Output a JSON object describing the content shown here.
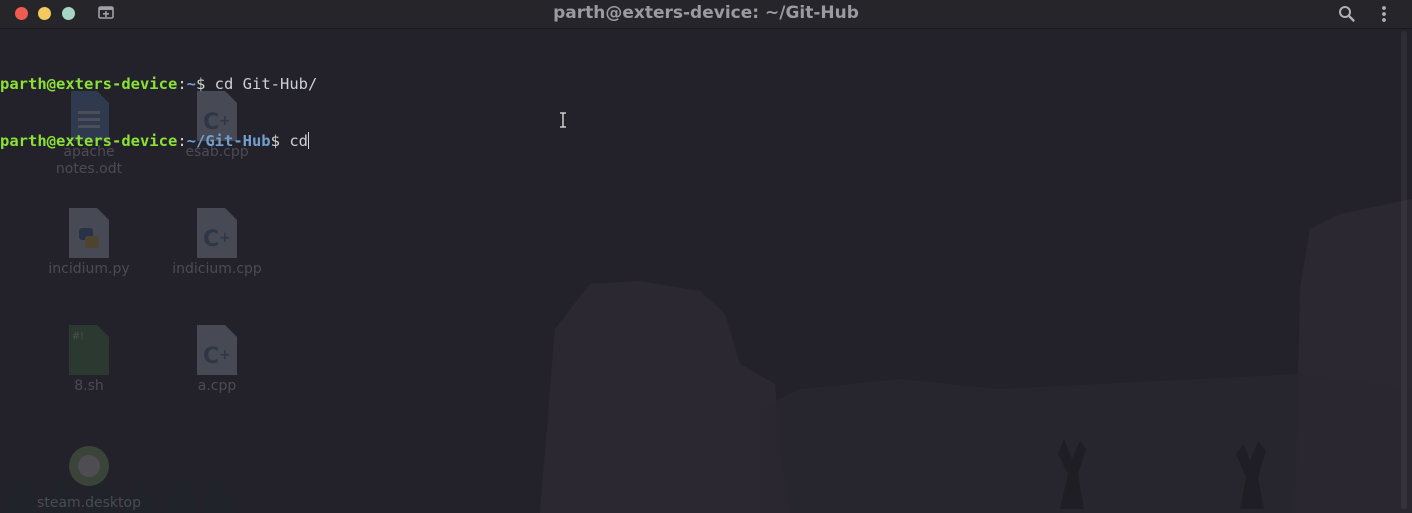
{
  "window": {
    "title": "parth@exters-device: ~/Git-Hub",
    "controls": [
      "close",
      "minimize",
      "maximize"
    ],
    "new_tab_icon": "new-tab-icon",
    "search_icon": "search-icon",
    "menu_icon": "kebab-menu-icon"
  },
  "terminal": {
    "lines": [
      {
        "user_host": "parth@exters-device",
        "colon": ":",
        "path": "~",
        "symbol": "$",
        "command": " cd Git-Hub/"
      },
      {
        "user_host": "parth@exters-device",
        "colon": ":",
        "path": "~/Git-Hub",
        "symbol": "$",
        "command": " cd"
      }
    ]
  },
  "desktop_icons": [
    {
      "label_line1": "apache",
      "label_line2": "notes.odt",
      "icon": "document-icon"
    },
    {
      "label": "esab.cpp",
      "icon": "cpp-file-icon"
    },
    {
      "label": "incidium.py",
      "icon": "python-file-icon"
    },
    {
      "label": "indicium.cpp",
      "icon": "cpp-file-icon"
    },
    {
      "label": "8.sh",
      "icon": "shell-script-icon"
    },
    {
      "label": "a.cpp",
      "icon": "cpp-file-icon"
    },
    {
      "label": "steam.desktop",
      "icon": "steam-icon"
    }
  ],
  "colors": {
    "prompt_user": "#8ae234",
    "prompt_path": "#729fcf",
    "text": "#d3d7cf",
    "background": "#23222b",
    "titlebar": "#26262a"
  }
}
